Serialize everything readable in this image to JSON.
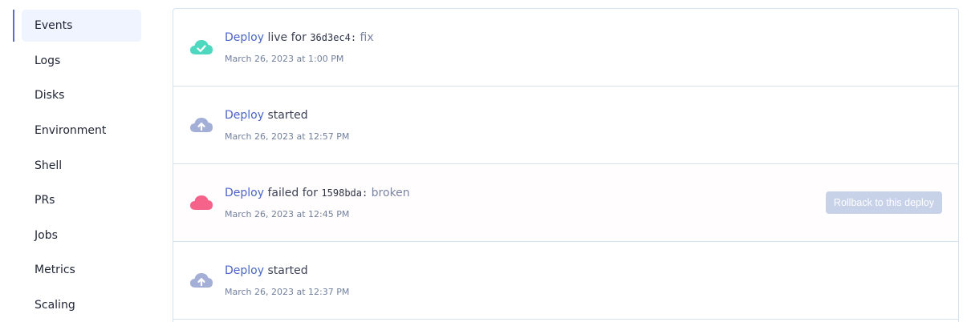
{
  "sidebar": {
    "items": [
      {
        "label": "Events",
        "active": true
      },
      {
        "label": "Logs"
      },
      {
        "label": "Disks"
      },
      {
        "label": "Environment"
      },
      {
        "label": "Shell"
      },
      {
        "label": "PRs"
      },
      {
        "label": "Jobs"
      },
      {
        "label": "Metrics"
      },
      {
        "label": "Scaling"
      }
    ]
  },
  "events": [
    {
      "status": "success",
      "icon": "cloud-check-icon",
      "link": "Deploy",
      "text": " live for ",
      "commit": "36d3ec4:",
      "message": " fix",
      "time": "March 26, 2023 at 1:00 PM"
    },
    {
      "status": "started",
      "icon": "cloud-upload-icon",
      "link": "Deploy",
      "text": " started",
      "time": "March 26, 2023 at 12:57 PM"
    },
    {
      "status": "failed",
      "icon": "cloud-failed-icon",
      "link": "Deploy",
      "text": " failed for ",
      "commit": "1598bda:",
      "message": " broken",
      "time": "March 26, 2023 at 12:45 PM",
      "action": "Rollback to this deploy"
    },
    {
      "status": "started",
      "icon": "cloud-upload-icon",
      "link": "Deploy",
      "text": " started",
      "time": "March 26, 2023 at 12:37 PM"
    }
  ],
  "colors": {
    "accent": "#4b64c7",
    "success": "#4fd8c0",
    "started": "#a3afd6",
    "failed": "#f5638a",
    "rollback_bg": "#c7d1e8"
  }
}
